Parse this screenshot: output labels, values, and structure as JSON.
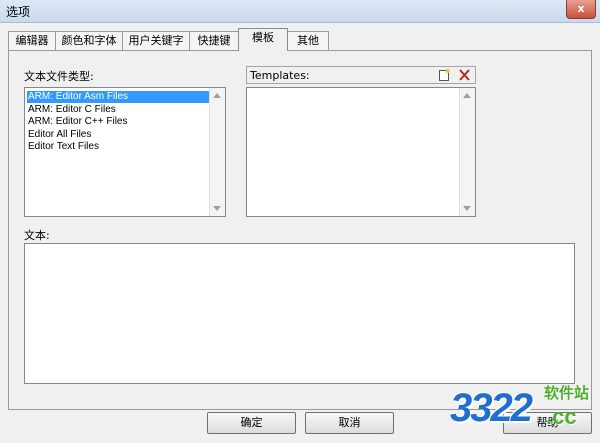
{
  "window": {
    "title": "选项",
    "close_label": "x"
  },
  "tabs": [
    {
      "label": "编辑器"
    },
    {
      "label": "颜色和字体"
    },
    {
      "label": "用户关键字"
    },
    {
      "label": "快捷键"
    },
    {
      "label": "模板"
    },
    {
      "label": "其他"
    }
  ],
  "active_tab": "模板",
  "file_types": {
    "label": "文本文件类型:",
    "items": [
      {
        "label": "ARM: Editor Asm Files",
        "selected": true
      },
      {
        "label": "ARM: Editor C Files"
      },
      {
        "label": "ARM: Editor C++ Files"
      },
      {
        "label": "Editor All Files"
      },
      {
        "label": "Editor Text Files"
      }
    ]
  },
  "templates": {
    "label": "Templates:",
    "new_icon": "new-icon",
    "delete_icon": "delete-icon"
  },
  "text_area": {
    "label": "文本:",
    "value": ""
  },
  "buttons": {
    "ok": "确定",
    "cancel": "取消",
    "help": "帮助"
  },
  "watermark": {
    "digits": "3322",
    "site": "软件站",
    "suffix": ".cc"
  },
  "colors": {
    "selection": "#3399ff",
    "logo_blue": "#1e6fd0",
    "logo_green": "#4fae2f"
  }
}
